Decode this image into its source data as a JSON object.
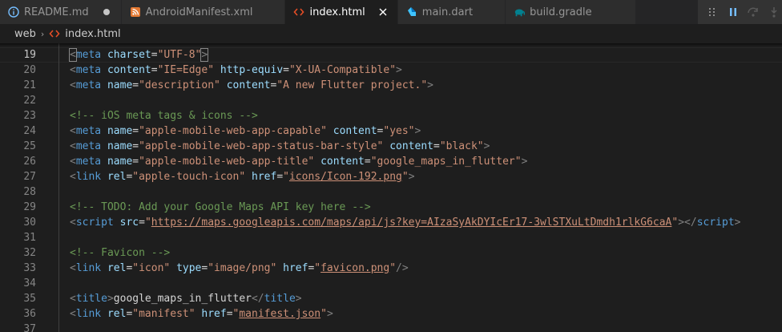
{
  "tabs": [
    {
      "label": "README.md",
      "icon": "info-icon",
      "end": "unsaved-dot"
    },
    {
      "label": "AndroidManifest.xml",
      "icon": "rss-icon",
      "end": ""
    },
    {
      "label": "index.html",
      "icon": "html-icon",
      "end": "close"
    },
    {
      "label": "main.dart",
      "icon": "dart-icon",
      "end": ""
    },
    {
      "label": "build.gradle",
      "icon": "gradle-elephant-icon",
      "end": ""
    }
  ],
  "breadcrumb": {
    "folder": "web",
    "separator": "›",
    "file": "index.html"
  },
  "editor": {
    "current_line": 19,
    "lines": [
      {
        "num": "19",
        "tokens": [
          [
            "tagb",
            "<"
          ],
          [
            "tag",
            "meta"
          ],
          [
            "txt",
            " "
          ],
          [
            "attr",
            "charset"
          ],
          [
            "txt",
            "="
          ],
          [
            "str",
            "\"UTF-8\""
          ],
          [
            "tagb",
            ">"
          ]
        ]
      },
      {
        "num": "20",
        "tokens": [
          [
            "tagb",
            "<"
          ],
          [
            "tag",
            "meta"
          ],
          [
            "txt",
            " "
          ],
          [
            "attr",
            "content"
          ],
          [
            "txt",
            "="
          ],
          [
            "str",
            "\"IE=Edge\""
          ],
          [
            "txt",
            " "
          ],
          [
            "attr",
            "http-equiv"
          ],
          [
            "txt",
            "="
          ],
          [
            "str",
            "\"X-UA-Compatible\""
          ],
          [
            "tagb",
            ">"
          ]
        ]
      },
      {
        "num": "21",
        "tokens": [
          [
            "tagb",
            "<"
          ],
          [
            "tag",
            "meta"
          ],
          [
            "txt",
            " "
          ],
          [
            "attr",
            "name"
          ],
          [
            "txt",
            "="
          ],
          [
            "str",
            "\"description\""
          ],
          [
            "txt",
            " "
          ],
          [
            "attr",
            "content"
          ],
          [
            "txt",
            "="
          ],
          [
            "str",
            "\"A new Flutter project.\""
          ],
          [
            "tagb",
            ">"
          ]
        ]
      },
      {
        "num": "22",
        "tokens": []
      },
      {
        "num": "23",
        "tokens": [
          [
            "cmt",
            "<!-- iOS meta tags & icons -->"
          ]
        ]
      },
      {
        "num": "24",
        "tokens": [
          [
            "tagb",
            "<"
          ],
          [
            "tag",
            "meta"
          ],
          [
            "txt",
            " "
          ],
          [
            "attr",
            "name"
          ],
          [
            "txt",
            "="
          ],
          [
            "str",
            "\"apple-mobile-web-app-capable\""
          ],
          [
            "txt",
            " "
          ],
          [
            "attr",
            "content"
          ],
          [
            "txt",
            "="
          ],
          [
            "str",
            "\"yes\""
          ],
          [
            "tagb",
            ">"
          ]
        ]
      },
      {
        "num": "25",
        "tokens": [
          [
            "tagb",
            "<"
          ],
          [
            "tag",
            "meta"
          ],
          [
            "txt",
            " "
          ],
          [
            "attr",
            "name"
          ],
          [
            "txt",
            "="
          ],
          [
            "str",
            "\"apple-mobile-web-app-status-bar-style\""
          ],
          [
            "txt",
            " "
          ],
          [
            "attr",
            "content"
          ],
          [
            "txt",
            "="
          ],
          [
            "str",
            "\"black\""
          ],
          [
            "tagb",
            ">"
          ]
        ]
      },
      {
        "num": "26",
        "tokens": [
          [
            "tagb",
            "<"
          ],
          [
            "tag",
            "meta"
          ],
          [
            "txt",
            " "
          ],
          [
            "attr",
            "name"
          ],
          [
            "txt",
            "="
          ],
          [
            "str",
            "\"apple-mobile-web-app-title\""
          ],
          [
            "txt",
            " "
          ],
          [
            "attr",
            "content"
          ],
          [
            "txt",
            "="
          ],
          [
            "str",
            "\"google_maps_in_flutter\""
          ],
          [
            "tagb",
            ">"
          ]
        ]
      },
      {
        "num": "27",
        "tokens": [
          [
            "tagb",
            "<"
          ],
          [
            "tag",
            "link"
          ],
          [
            "txt",
            " "
          ],
          [
            "attr",
            "rel"
          ],
          [
            "txt",
            "="
          ],
          [
            "str",
            "\"apple-touch-icon\""
          ],
          [
            "txt",
            " "
          ],
          [
            "attr",
            "href"
          ],
          [
            "txt",
            "="
          ],
          [
            "str",
            "\""
          ],
          [
            "link",
            "icons/Icon-192.png"
          ],
          [
            "str",
            "\""
          ],
          [
            "tagb",
            ">"
          ]
        ]
      },
      {
        "num": "28",
        "tokens": []
      },
      {
        "num": "29",
        "tokens": [
          [
            "cmt",
            "<!-- TODO: Add your Google Maps API key here -->"
          ]
        ]
      },
      {
        "num": "30",
        "tokens": [
          [
            "tagb",
            "<"
          ],
          [
            "tag",
            "script"
          ],
          [
            "txt",
            " "
          ],
          [
            "attr",
            "src"
          ],
          [
            "txt",
            "="
          ],
          [
            "str",
            "\""
          ],
          [
            "link",
            "https://maps.googleapis.com/maps/api/js?key=AIzaSyAkDYIcEr17-3wlSTXuLtDmdh1rlkG6caA"
          ],
          [
            "str",
            "\""
          ],
          [
            "tagb",
            "></"
          ],
          [
            "tag",
            "script"
          ],
          [
            "tagb",
            ">"
          ]
        ]
      },
      {
        "num": "31",
        "tokens": []
      },
      {
        "num": "32",
        "tokens": [
          [
            "cmt",
            "<!-- Favicon -->"
          ]
        ]
      },
      {
        "num": "33",
        "tokens": [
          [
            "tagb",
            "<"
          ],
          [
            "tag",
            "link"
          ],
          [
            "txt",
            " "
          ],
          [
            "attr",
            "rel"
          ],
          [
            "txt",
            "="
          ],
          [
            "str",
            "\"icon\""
          ],
          [
            "txt",
            " "
          ],
          [
            "attr",
            "type"
          ],
          [
            "txt",
            "="
          ],
          [
            "str",
            "\"image/png\""
          ],
          [
            "txt",
            " "
          ],
          [
            "attr",
            "href"
          ],
          [
            "txt",
            "="
          ],
          [
            "str",
            "\""
          ],
          [
            "link",
            "favicon.png"
          ],
          [
            "str",
            "\""
          ],
          [
            "tagb",
            "/>"
          ]
        ]
      },
      {
        "num": "34",
        "tokens": []
      },
      {
        "num": "35",
        "tokens": [
          [
            "tagb",
            "<"
          ],
          [
            "tag",
            "title"
          ],
          [
            "tagb",
            ">"
          ],
          [
            "txt",
            "google_maps_in_flutter"
          ],
          [
            "tagb",
            "</"
          ],
          [
            "tag",
            "title"
          ],
          [
            "tagb",
            ">"
          ]
        ]
      },
      {
        "num": "36",
        "tokens": [
          [
            "tagb",
            "<"
          ],
          [
            "tag",
            "link"
          ],
          [
            "txt",
            " "
          ],
          [
            "attr",
            "rel"
          ],
          [
            "txt",
            "="
          ],
          [
            "str",
            "\"manifest\""
          ],
          [
            "txt",
            " "
          ],
          [
            "attr",
            "href"
          ],
          [
            "txt",
            "="
          ],
          [
            "str",
            "\""
          ],
          [
            "link",
            "manifest.json"
          ],
          [
            "str",
            "\""
          ],
          [
            "tagb",
            ">"
          ]
        ]
      },
      {
        "num": "37",
        "tokens": []
      }
    ]
  },
  "colors": {
    "background": "#1e1e1e",
    "tab_inactive": "#2d2d2d",
    "tag": "#569cd6",
    "attribute": "#9cdcfe",
    "string": "#ce9178",
    "comment": "#6a9955"
  }
}
